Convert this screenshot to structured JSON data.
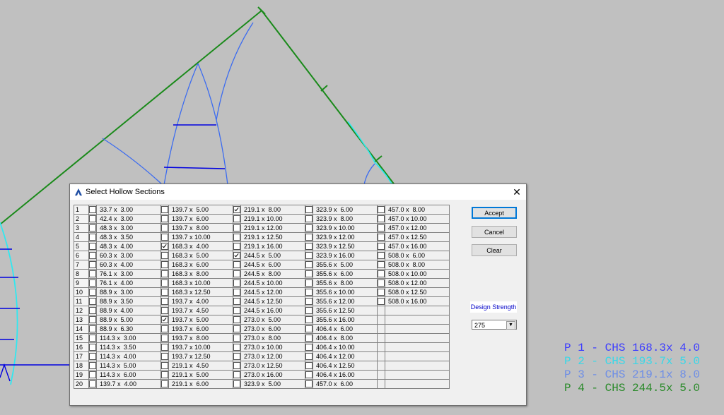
{
  "dialog": {
    "title": "Select Hollow Sections",
    "close": "✕",
    "buttons": {
      "accept": "Accept",
      "cancel": "Cancel",
      "clear": "Clear"
    },
    "design_strength_label": "Design Strength",
    "design_strength_value": "275",
    "rows": [
      {
        "n": "1",
        "c": [
          {
            "s": "33.7 x  3.00",
            "k": false
          },
          {
            "s": "139.7 x  5.00",
            "k": false
          },
          {
            "s": "219.1 x  8.00",
            "k": true
          },
          {
            "s": "323.9 x  6.00",
            "k": false
          },
          {
            "s": "457.0 x  8.00",
            "k": false
          }
        ]
      },
      {
        "n": "2",
        "c": [
          {
            "s": "42.4 x  3.00",
            "k": false
          },
          {
            "s": "139.7 x  6.00",
            "k": false
          },
          {
            "s": "219.1 x 10.00",
            "k": false
          },
          {
            "s": "323.9 x  8.00",
            "k": false
          },
          {
            "s": "457.0 x 10.00",
            "k": false
          }
        ]
      },
      {
        "n": "3",
        "c": [
          {
            "s": "48.3 x  3.00",
            "k": false
          },
          {
            "s": "139.7 x  8.00",
            "k": false
          },
          {
            "s": "219.1 x 12.00",
            "k": false
          },
          {
            "s": "323.9 x 10.00",
            "k": false
          },
          {
            "s": "457.0 x 12.00",
            "k": false
          }
        ]
      },
      {
        "n": "4",
        "c": [
          {
            "s": "48.3 x  3.50",
            "k": false
          },
          {
            "s": "139.7 x 10.00",
            "k": false
          },
          {
            "s": "219.1 x 12.50",
            "k": false
          },
          {
            "s": "323.9 x 12.00",
            "k": false
          },
          {
            "s": "457.0 x 12.50",
            "k": false
          }
        ]
      },
      {
        "n": "5",
        "c": [
          {
            "s": "48.3 x  4.00",
            "k": false
          },
          {
            "s": "168.3 x  4.00",
            "k": true
          },
          {
            "s": "219.1 x 16.00",
            "k": false
          },
          {
            "s": "323.9 x 12.50",
            "k": false
          },
          {
            "s": "457.0 x 16.00",
            "k": false
          }
        ]
      },
      {
        "n": "6",
        "c": [
          {
            "s": "60.3 x  3.00",
            "k": false
          },
          {
            "s": "168.3 x  5.00",
            "k": false
          },
          {
            "s": "244.5 x  5.00",
            "k": true
          },
          {
            "s": "323.9 x 16.00",
            "k": false
          },
          {
            "s": "508.0 x  6.00",
            "k": false
          }
        ]
      },
      {
        "n": "7",
        "c": [
          {
            "s": "60.3 x  4.00",
            "k": false
          },
          {
            "s": "168.3 x  6.00",
            "k": false
          },
          {
            "s": "244.5 x  6.00",
            "k": false
          },
          {
            "s": "355.6 x  5.00",
            "k": false
          },
          {
            "s": "508.0 x  8.00",
            "k": false
          }
        ]
      },
      {
        "n": "8",
        "c": [
          {
            "s": "76.1 x  3.00",
            "k": false
          },
          {
            "s": "168.3 x  8.00",
            "k": false
          },
          {
            "s": "244.5 x  8.00",
            "k": false
          },
          {
            "s": "355.6 x  6.00",
            "k": false
          },
          {
            "s": "508.0 x 10.00",
            "k": false
          }
        ]
      },
      {
        "n": "9",
        "c": [
          {
            "s": "76.1 x  4.00",
            "k": false
          },
          {
            "s": "168.3 x 10.00",
            "k": false
          },
          {
            "s": "244.5 x 10.00",
            "k": false
          },
          {
            "s": "355.6 x  8.00",
            "k": false
          },
          {
            "s": "508.0 x 12.00",
            "k": false
          }
        ]
      },
      {
        "n": "10",
        "c": [
          {
            "s": "88.9 x  3.00",
            "k": false
          },
          {
            "s": "168.3 x 12.50",
            "k": false
          },
          {
            "s": "244.5 x 12.00",
            "k": false
          },
          {
            "s": "355.6 x 10.00",
            "k": false
          },
          {
            "s": "508.0 x 12.50",
            "k": false
          }
        ]
      },
      {
        "n": "11",
        "c": [
          {
            "s": "88.9 x  3.50",
            "k": false
          },
          {
            "s": "193.7 x  4.00",
            "k": false
          },
          {
            "s": "244.5 x 12.50",
            "k": false
          },
          {
            "s": "355.6 x 12.00",
            "k": false
          },
          {
            "s": "508.0 x 16.00",
            "k": false
          }
        ]
      },
      {
        "n": "12",
        "c": [
          {
            "s": "88.9 x  4.00",
            "k": false
          },
          {
            "s": "193.7 x  4.50",
            "k": false
          },
          {
            "s": "244.5 x 16.00",
            "k": false
          },
          {
            "s": "355.6 x 12.50",
            "k": false
          },
          null
        ]
      },
      {
        "n": "13",
        "c": [
          {
            "s": "88.9 x  5.00",
            "k": false
          },
          {
            "s": "193.7 x  5.00",
            "k": true
          },
          {
            "s": "273.0 x  5.00",
            "k": false
          },
          {
            "s": "355.6 x 16.00",
            "k": false
          },
          null
        ]
      },
      {
        "n": "14",
        "c": [
          {
            "s": "88.9 x  6.30",
            "k": false
          },
          {
            "s": "193.7 x  6.00",
            "k": false
          },
          {
            "s": "273.0 x  6.00",
            "k": false
          },
          {
            "s": "406.4 x  6.00",
            "k": false
          },
          null
        ]
      },
      {
        "n": "15",
        "c": [
          {
            "s": "114.3 x  3.00",
            "k": false
          },
          {
            "s": "193.7 x  8.00",
            "k": false
          },
          {
            "s": "273.0 x  8.00",
            "k": false
          },
          {
            "s": "406.4 x  8.00",
            "k": false
          },
          null
        ]
      },
      {
        "n": "16",
        "c": [
          {
            "s": "114.3 x  3.50",
            "k": false
          },
          {
            "s": "193.7 x 10.00",
            "k": false
          },
          {
            "s": "273.0 x 10.00",
            "k": false
          },
          {
            "s": "406.4 x 10.00",
            "k": false
          },
          null
        ]
      },
      {
        "n": "17",
        "c": [
          {
            "s": "114.3 x  4.00",
            "k": false
          },
          {
            "s": "193.7 x 12.50",
            "k": false
          },
          {
            "s": "273.0 x 12.00",
            "k": false
          },
          {
            "s": "406.4 x 12.00",
            "k": false
          },
          null
        ]
      },
      {
        "n": "18",
        "c": [
          {
            "s": "114.3 x  5.00",
            "k": false
          },
          {
            "s": "219.1 x  4.50",
            "k": false
          },
          {
            "s": "273.0 x 12.50",
            "k": false
          },
          {
            "s": "406.4 x 12.50",
            "k": false
          },
          null
        ]
      },
      {
        "n": "19",
        "c": [
          {
            "s": "114.3 x  6.00",
            "k": false
          },
          {
            "s": "219.1 x  5.00",
            "k": false
          },
          {
            "s": "273.0 x 16.00",
            "k": false
          },
          {
            "s": "406.4 x 16.00",
            "k": false
          },
          null
        ]
      },
      {
        "n": "20",
        "c": [
          {
            "s": "139.7 x  4.00",
            "k": false
          },
          {
            "s": "219.1 x  6.00",
            "k": false
          },
          {
            "s": "323.9 x  5.00",
            "k": false
          },
          {
            "s": "457.0 x  6.00",
            "k": false
          },
          null
        ]
      }
    ]
  },
  "legend": [
    {
      "text": "P 1 - CHS 168.3x 4.0",
      "color": "#3c3cff"
    },
    {
      "text": "P 2 - CHS 193.7x 5.0",
      "color": "#38d8e8"
    },
    {
      "text": "P 3 - CHS 219.1x 8.0",
      "color": "#6e8ee6"
    },
    {
      "text": "P 4 - CHS 244.5x 5.0",
      "color": "#2a8a2a"
    }
  ],
  "colors": {
    "canvas": "#c0c0c0",
    "chord": "#1a8a1a",
    "member": "#3c6cf0",
    "cyan": "#30e8f0",
    "blue": "#0000e0"
  }
}
